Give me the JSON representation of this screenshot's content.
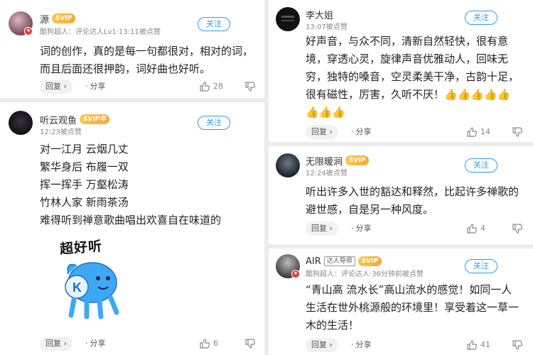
{
  "labels": {
    "follow": "关注",
    "reply": "回复",
    "share": "分享",
    "svip": "SVIP",
    "svip_year": "SVIP年"
  },
  "comments": [
    {
      "name": "源",
      "meta": "酷狗超人：评论达人Lv1·13:11被点赞",
      "lines": [
        "词的创作，真的是每一句都很对，相对的词，",
        "而且后面还很押韵，词好曲也好听。"
      ],
      "likes": "28"
    },
    {
      "name": "听云观鱼",
      "meta": "12:23被点赞",
      "lines": [
        "对一江月 云烟几丈",
        "繁华身后 布履一双",
        "挥一挥手 万壑松涛",
        "竹林人家 新雨茶汤",
        "难得听到禅意歌曲唱出欢喜自在味道的"
      ],
      "sticker_text": "超好听",
      "likes": "6"
    },
    {
      "name": "李大姐",
      "meta": "13:07被点赞",
      "lines": [
        "好声音，与众不同，清新自然轻快，很有意",
        "境，穿透心灵，旋律声音优雅动人，回味无",
        "穷，独特的嗓音，空灵柔美干净，古韵十足，",
        "很有磁性，厉害，久听不厌！👍👍👍👍👍",
        "👍👍👍"
      ],
      "likes": "14"
    },
    {
      "name": "无限暖涧",
      "meta": "12:24被点赞",
      "lines": [
        "听出许多入世的豁达和释然，比起许多禅歌的",
        "避世感，自是另一种风度。"
      ],
      "likes": "4"
    },
    {
      "name": "AIR",
      "tag": "达人导师",
      "meta": "酷狗超人：评论达人·36分钟前被点赞",
      "lines": [
        "“青山高 流水长”高山流水的感觉！如同一人",
        "生活在世外桃源般的环境里！享受着这一草一",
        "木的生活！"
      ],
      "likes": "41"
    }
  ],
  "colors": {
    "accent": "#2d9cf5",
    "svip_gold": "#f3a93a",
    "thumb_yellow": "#f4b400"
  }
}
